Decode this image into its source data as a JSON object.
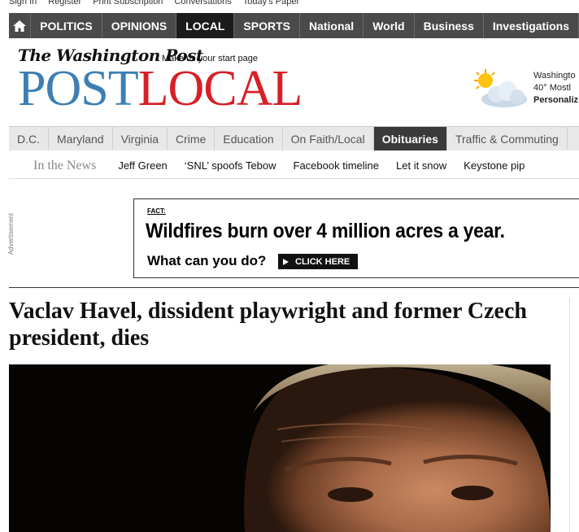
{
  "top_links": [
    "Sign In",
    "Register",
    "Print Subscription",
    "Conversations",
    "Today's Paper"
  ],
  "main_nav": {
    "items": [
      {
        "label": "POLITICS",
        "active": false
      },
      {
        "label": "OPINIONS",
        "active": false
      },
      {
        "label": "LOCAL",
        "active": true
      },
      {
        "label": "SPORTS",
        "active": false
      },
      {
        "label": "National",
        "active": false
      },
      {
        "label": "World",
        "active": false
      },
      {
        "label": "Business",
        "active": false
      },
      {
        "label": "Investigations",
        "active": false
      }
    ]
  },
  "masthead": {
    "paper_name": "The Washington Post",
    "start_page_link": "Make us your start page",
    "section_post": "POST",
    "section_local": "LOCAL"
  },
  "weather": {
    "icon": "partly-cloudy-icon",
    "line1": "Washingto",
    "line2": "40° Mostl",
    "line3": "Personaliz"
  },
  "local_nav": {
    "items": [
      {
        "label": "D.C.",
        "active": false
      },
      {
        "label": "Maryland",
        "active": false
      },
      {
        "label": "Virginia",
        "active": false
      },
      {
        "label": "Crime",
        "active": false
      },
      {
        "label": "Education",
        "active": false
      },
      {
        "label": "On Faith/Local",
        "active": false
      },
      {
        "label": "Obituaries",
        "active": true
      },
      {
        "label": "Traffic & Commuting",
        "active": false
      }
    ]
  },
  "in_the_news": {
    "label": "In the News",
    "links": [
      "Jeff Green",
      "‘SNL’ spoofs Tebow",
      "Facebook timeline",
      "Let it snow",
      "Keystone pip"
    ]
  },
  "advertisement": {
    "label": "Advertisement",
    "fact": "FACT:",
    "headline": "Wildfires burn over 4 million acres a year.",
    "question": "What can you do?",
    "cta": "CLICK HERE"
  },
  "article": {
    "headline": "Vaclav Havel, dissident playwright and former Czech president, dies"
  },
  "colors": {
    "nav_bg": "#4a4a4a",
    "post_blue": "#3d7fb3",
    "local_red": "#d71f26"
  }
}
